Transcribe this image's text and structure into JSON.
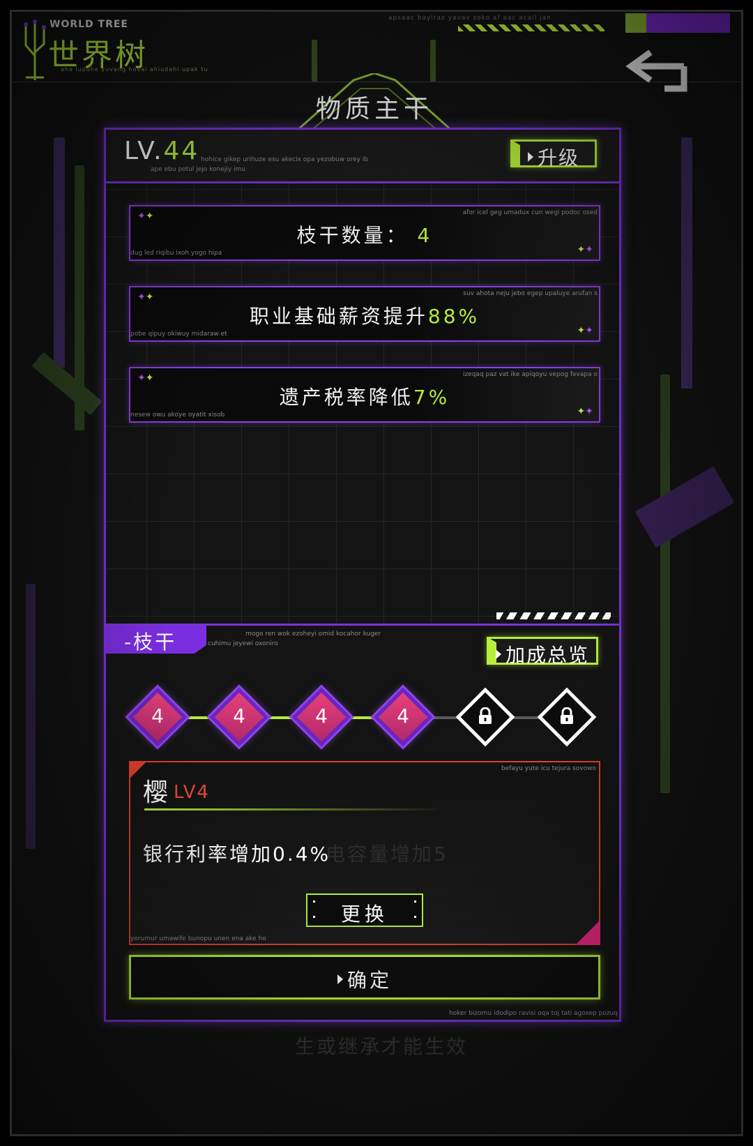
{
  "header": {
    "logo_small": "WORLD TREE",
    "logo_big": "世界树",
    "logo_sub": "aha lupuhe yuvang hoval ahiudahi upak tu",
    "top_noise": "apsaac baylraz yavav soko af aac acail jan",
    "back_icon": "back-arrow-icon"
  },
  "title": "物质主干",
  "level": {
    "prefix": "LV.",
    "value": "44",
    "noise1": "hohice gikep urihuze esu akecix opa yezobuw orey ib",
    "noise2": "ape ebu potul jejo konejiy imu"
  },
  "upgrade_button": "升级",
  "stats": [
    {
      "label": "枝干数量：",
      "value": "4",
      "noise_r": "afor icel geg umadux cun wegi podoc osed",
      "noise_l": "dug led riqibu ixoh yogo hipa"
    },
    {
      "label": "职业基础薪资提升",
      "value": "88%",
      "noise_r": "suv ahota neju jebo egep upaluye arufan s",
      "noise_l": "pobe qipuy okiwuy midaraw et"
    },
    {
      "label": "遗产税率降低",
      "value": "7%",
      "noise_r": "izeqaq paz vat ike apiqoyu vepog fevapa o",
      "noise_l": "nesew owu akoye oyatit xisob"
    }
  ],
  "branch_section": {
    "tab_label": "-枝干",
    "noise1": "mogo ren wok ezoheyi omid kocahor kuger",
    "noise2": "cuhimu jeyewi oxoniro",
    "overview_button": "加成总览"
  },
  "branch_nodes": [
    {
      "label": "4",
      "state": "active"
    },
    {
      "label": "4",
      "state": "active"
    },
    {
      "label": "4",
      "state": "active"
    },
    {
      "label": "4",
      "state": "active"
    },
    {
      "label": "",
      "state": "locked",
      "icon": "lock-icon"
    },
    {
      "label": "",
      "state": "locked",
      "icon": "lock-icon"
    }
  ],
  "detail": {
    "name": "樱",
    "level": "LV4",
    "effect": "银行利率增加0.4%",
    "ghost_text": "电容量增加5",
    "noise_r": "befayu yute icu tejura sovowo",
    "noise_l": "yorumur umawife bunopu unen ena ake ho",
    "swap_button": "更换"
  },
  "confirm_button": "确定",
  "panel_noise": "hoker bizomu idodipo ravisi oqa toj tati agoxep pozuq",
  "footer_ghost": "生或继承才能生效",
  "colors": {
    "accent_green": "#b8ee3c",
    "accent_purple": "#7b33d6",
    "node_pink": "#e8417a",
    "detail_red": "#e0412b"
  }
}
